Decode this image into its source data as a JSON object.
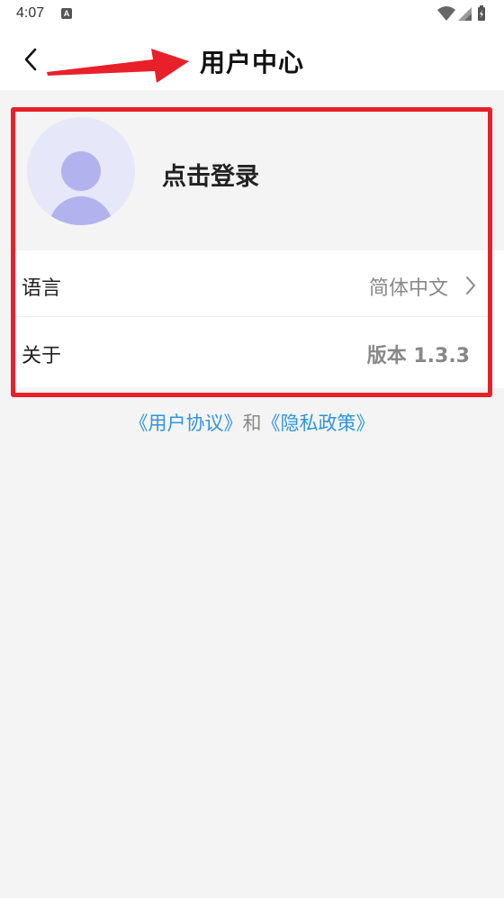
{
  "status_bar": {
    "time": "4:07",
    "notification_icon": "A"
  },
  "header": {
    "title": "用户中心",
    "back_icon": "chevron-left-icon"
  },
  "user_card": {
    "login_label": "点击登录",
    "avatar_icon": "user-avatar-icon"
  },
  "settings": {
    "language": {
      "label": "语言",
      "value": "简体中文"
    },
    "about": {
      "label": "关于",
      "value": "版本 1.3.3"
    }
  },
  "legal": {
    "user_agreement": "《用户协议》",
    "conjunction": "和",
    "privacy_policy": "《隐私政策》"
  },
  "colors": {
    "link": "#2e95db",
    "highlight": "#e8202a",
    "avatar_bg": "#e6e7f8",
    "avatar_fg": "#b2b2ee"
  }
}
